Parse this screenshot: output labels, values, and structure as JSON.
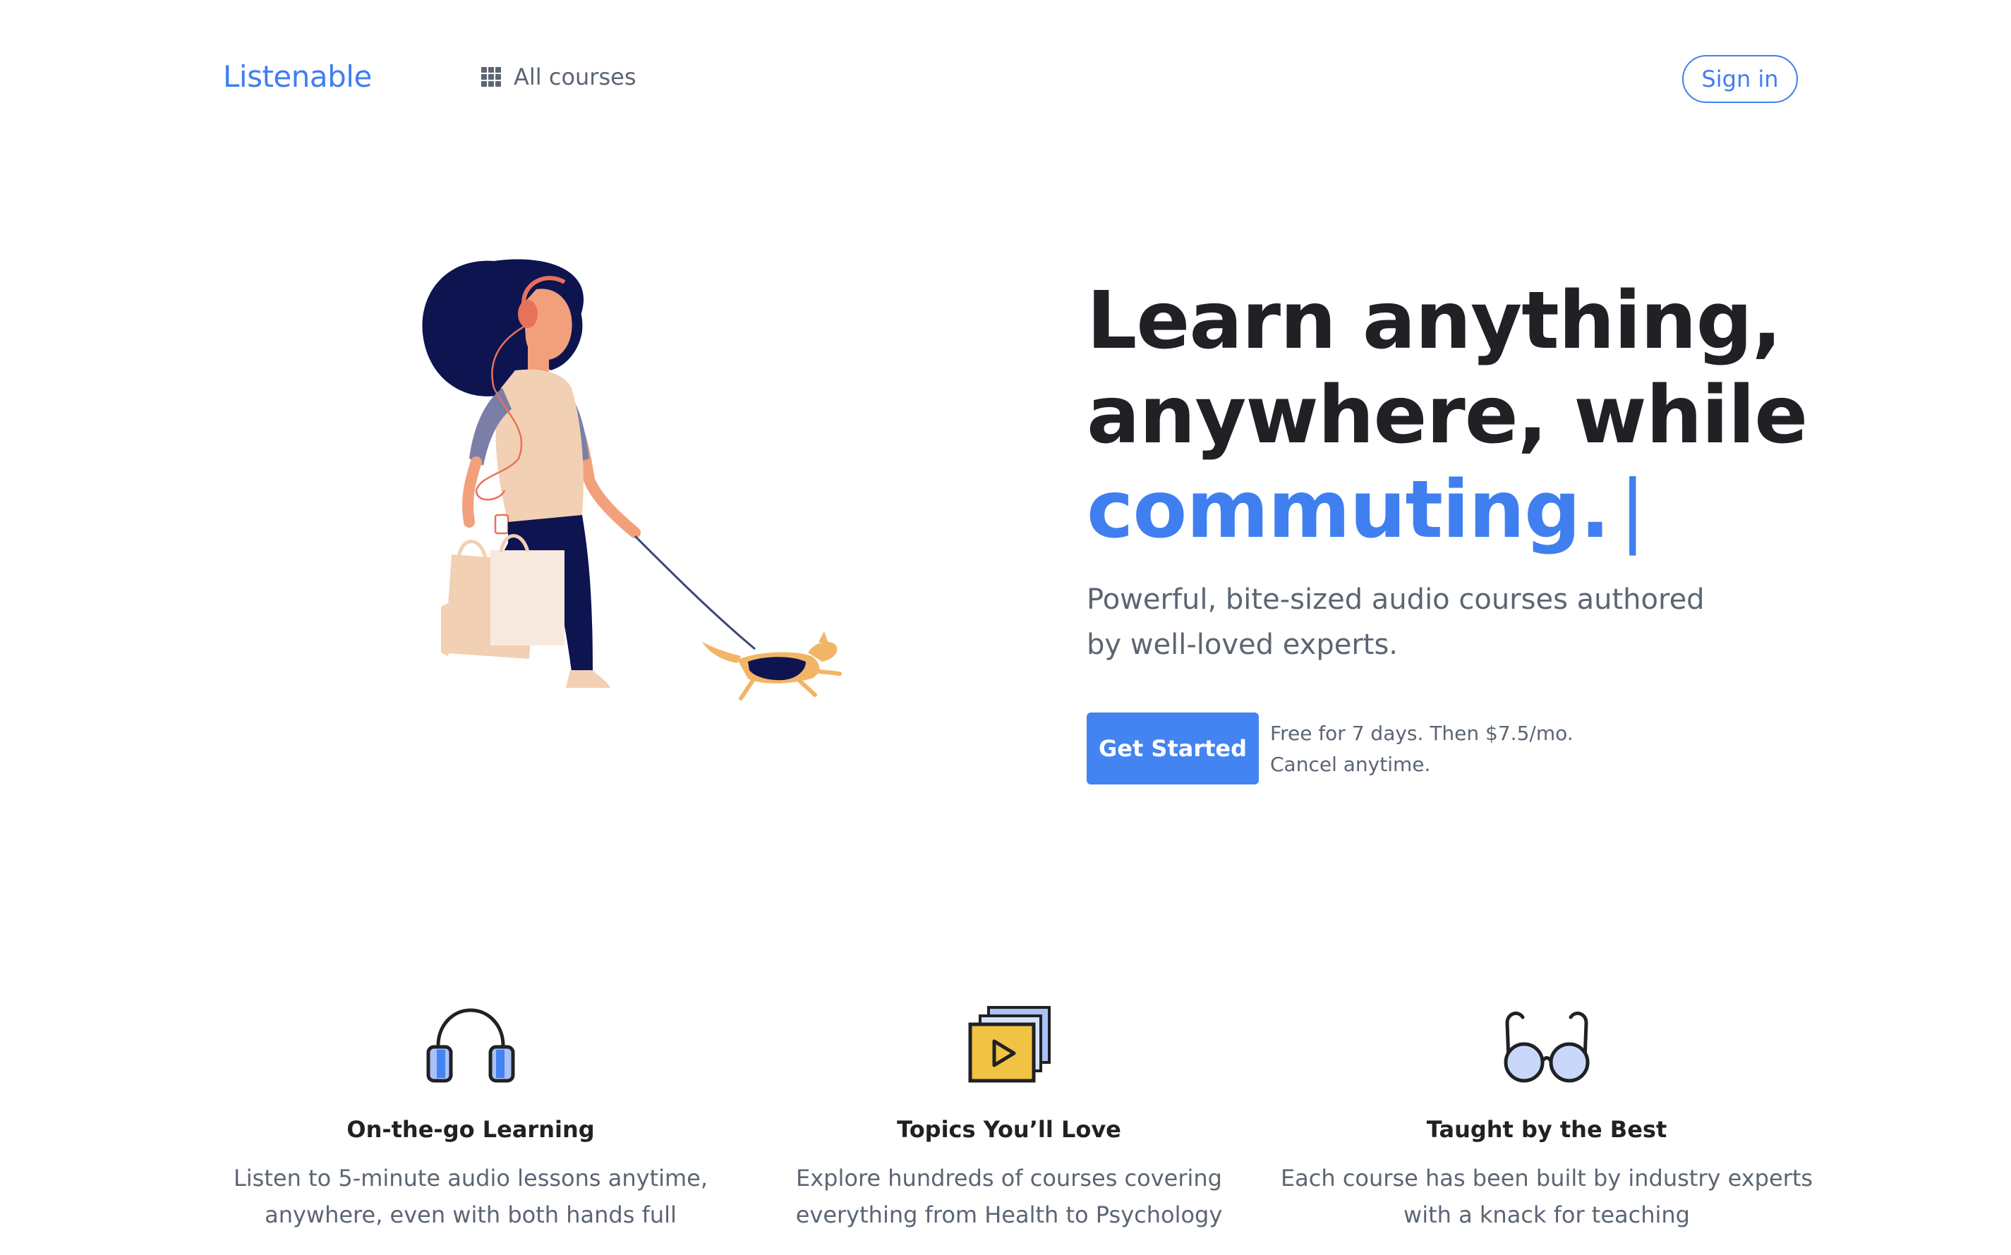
{
  "header": {
    "logo": "Listenable",
    "all_courses_label": "All courses",
    "sign_in_label": "Sign in"
  },
  "hero": {
    "headline_line1": "Learn anything,",
    "headline_line2": "anywhere, while",
    "headline_highlight": "commuting.",
    "cursor": "|",
    "subheadline": "Powerful, bite-sized audio courses authored by well-loved experts.",
    "cta_label": "Get Started",
    "pricing_note_line1": "Free for 7 days. Then $7.5/mo.",
    "pricing_note_line2": "Cancel anytime."
  },
  "features": [
    {
      "icon": "headphones-icon",
      "title": "On-the-go Learning",
      "desc_line1": "Listen to 5-minute audio lessons anytime,",
      "desc_line2": "anywhere, even with both hands full"
    },
    {
      "icon": "video-stack-icon",
      "title": "Topics You’ll Love",
      "desc_line1": "Explore hundreds of courses covering",
      "desc_line2": "everything from Health to Psychology"
    },
    {
      "icon": "glasses-icon",
      "title": "Taught by the Best",
      "desc_line1": "Each course has been built by industry experts",
      "desc_line2": "with a knack for teaching"
    }
  ],
  "colors": {
    "brand": "#3f7ff0",
    "cta": "#4383f2",
    "text": "#202124",
    "muted": "#5b6573"
  }
}
